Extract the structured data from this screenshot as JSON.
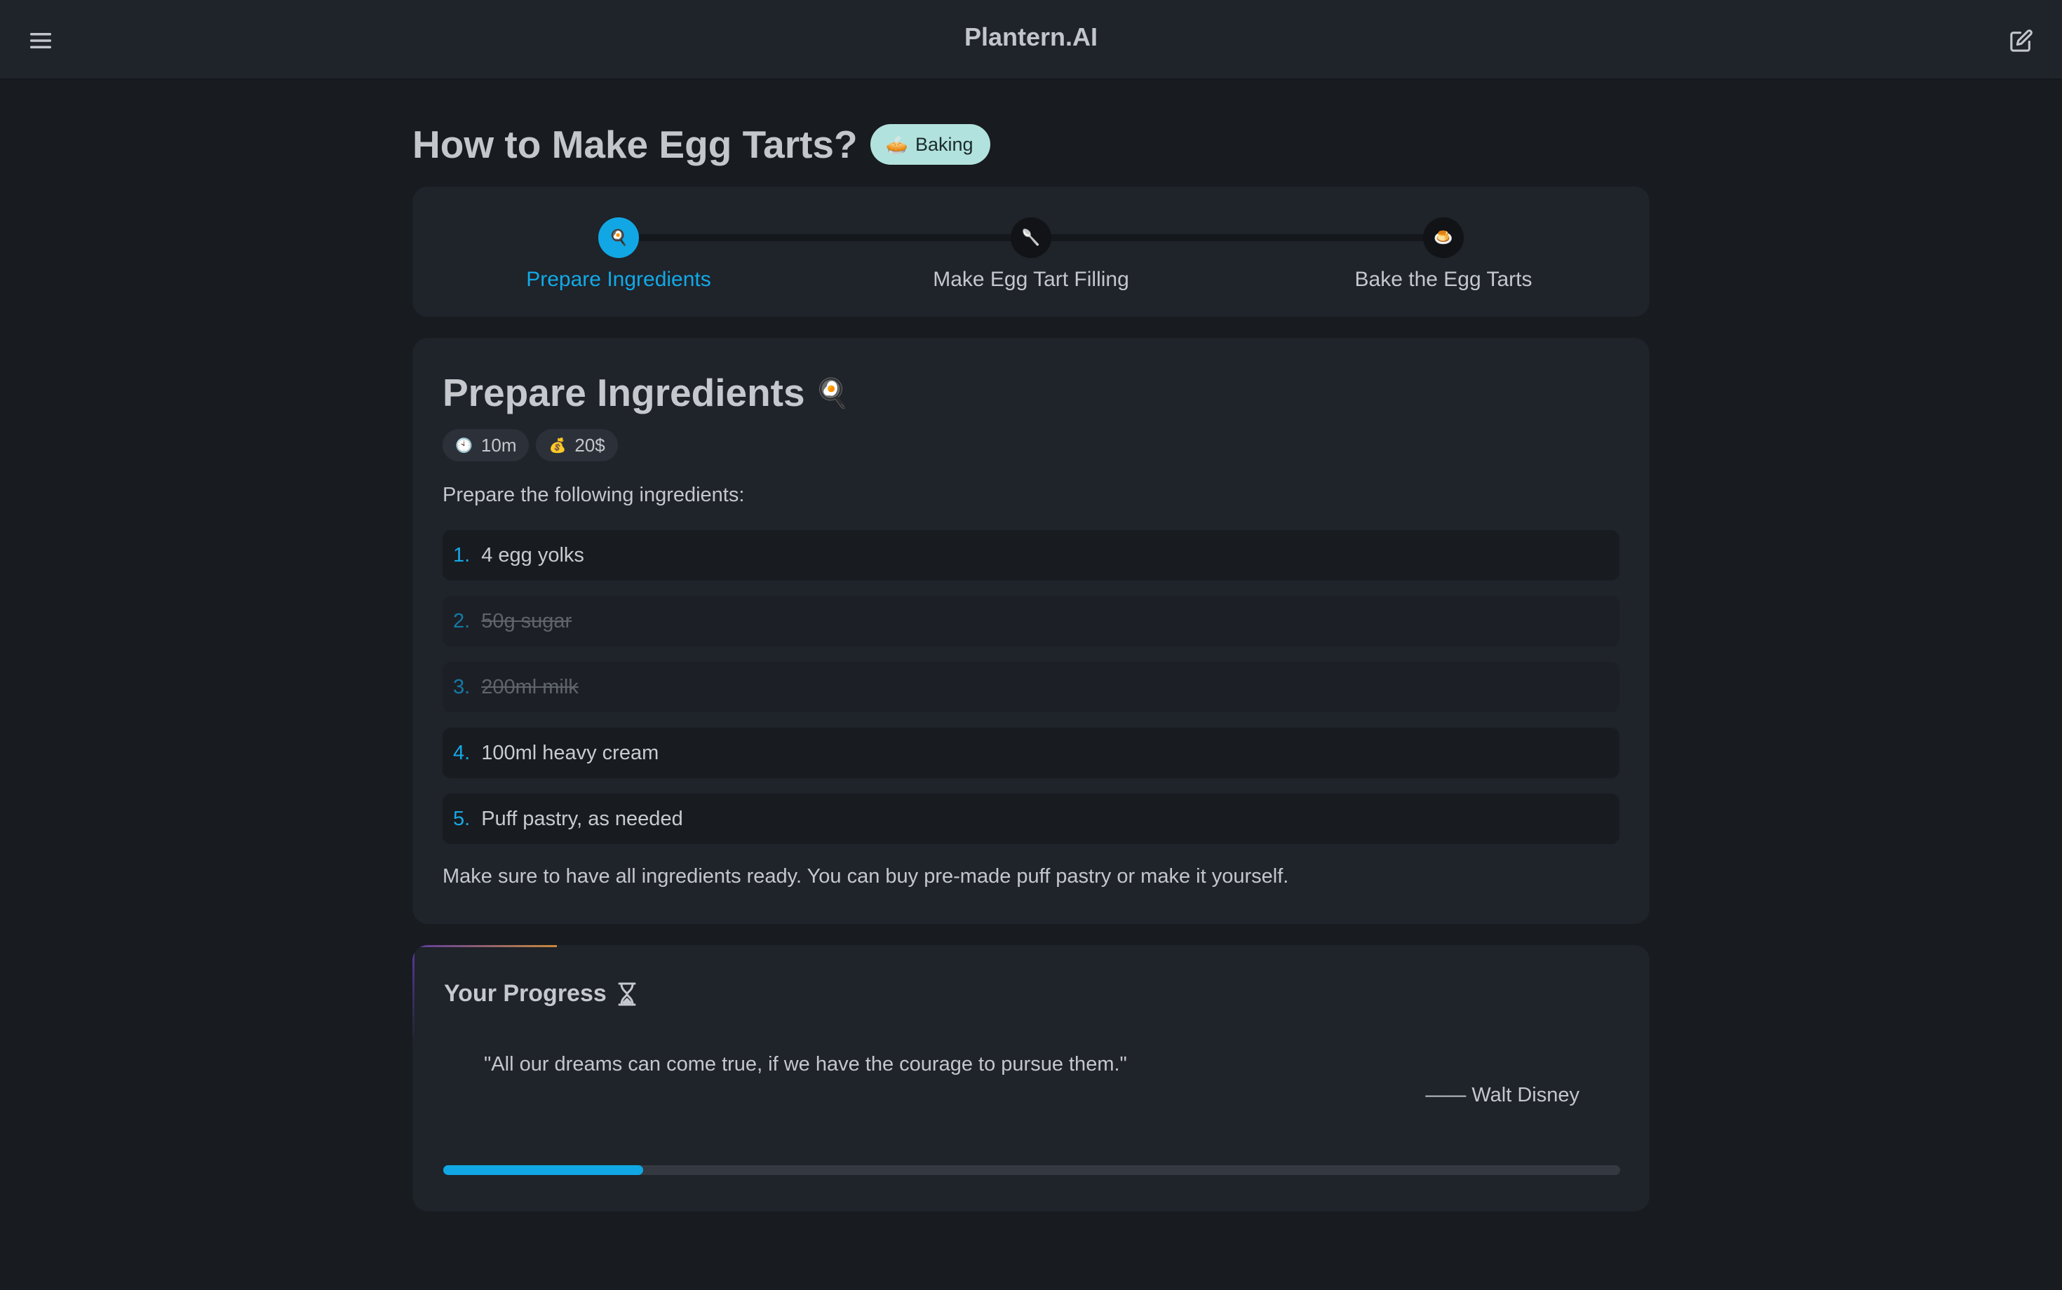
{
  "app": {
    "title": "Plantern.AI"
  },
  "icons": {
    "menu": "hamburger-menu-icon",
    "edit": "edit-icon",
    "category": "pie-emoji",
    "timer": "hourglass-icon"
  },
  "page": {
    "title": "How to Make Egg Tarts?",
    "category": {
      "emoji": "🥧",
      "label": "Baking"
    }
  },
  "steps": [
    {
      "emoji": "🍳",
      "label": "Prepare Ingredients",
      "active": true
    },
    {
      "emoji": "🥄",
      "label": "Make Egg Tart Filling",
      "active": false
    },
    {
      "emoji": "🍮",
      "label": "Bake the Egg Tarts",
      "active": false
    }
  ],
  "detail": {
    "title": "Prepare Ingredients",
    "emoji": "🍳",
    "time": {
      "emoji": "🕙",
      "value": "10m"
    },
    "cost": {
      "emoji": "💰",
      "value": "20$"
    },
    "intro": "Prepare the following ingredients:",
    "ingredients": [
      {
        "num": "1.",
        "text": "4 egg yolks",
        "done": false
      },
      {
        "num": "2.",
        "text": "50g sugar",
        "done": true
      },
      {
        "num": "3.",
        "text": "200ml milk",
        "done": true
      },
      {
        "num": "4.",
        "text": "100ml heavy cream",
        "done": false
      },
      {
        "num": "5.",
        "text": "Puff pastry, as needed",
        "done": false
      }
    ],
    "note": "Make sure to have all ingredients ready. You can buy pre-made puff pastry or make it yourself."
  },
  "progress": {
    "title": "Your Progress",
    "quote": "\"All our dreams can come true, if we have the courage to pursue them.\"",
    "author": "—— Walt Disney",
    "percent": 17
  },
  "colors": {
    "accent": "#10a7e4",
    "background": "#181b20",
    "card": "#1f232a",
    "badge": "#b2e2dd"
  }
}
